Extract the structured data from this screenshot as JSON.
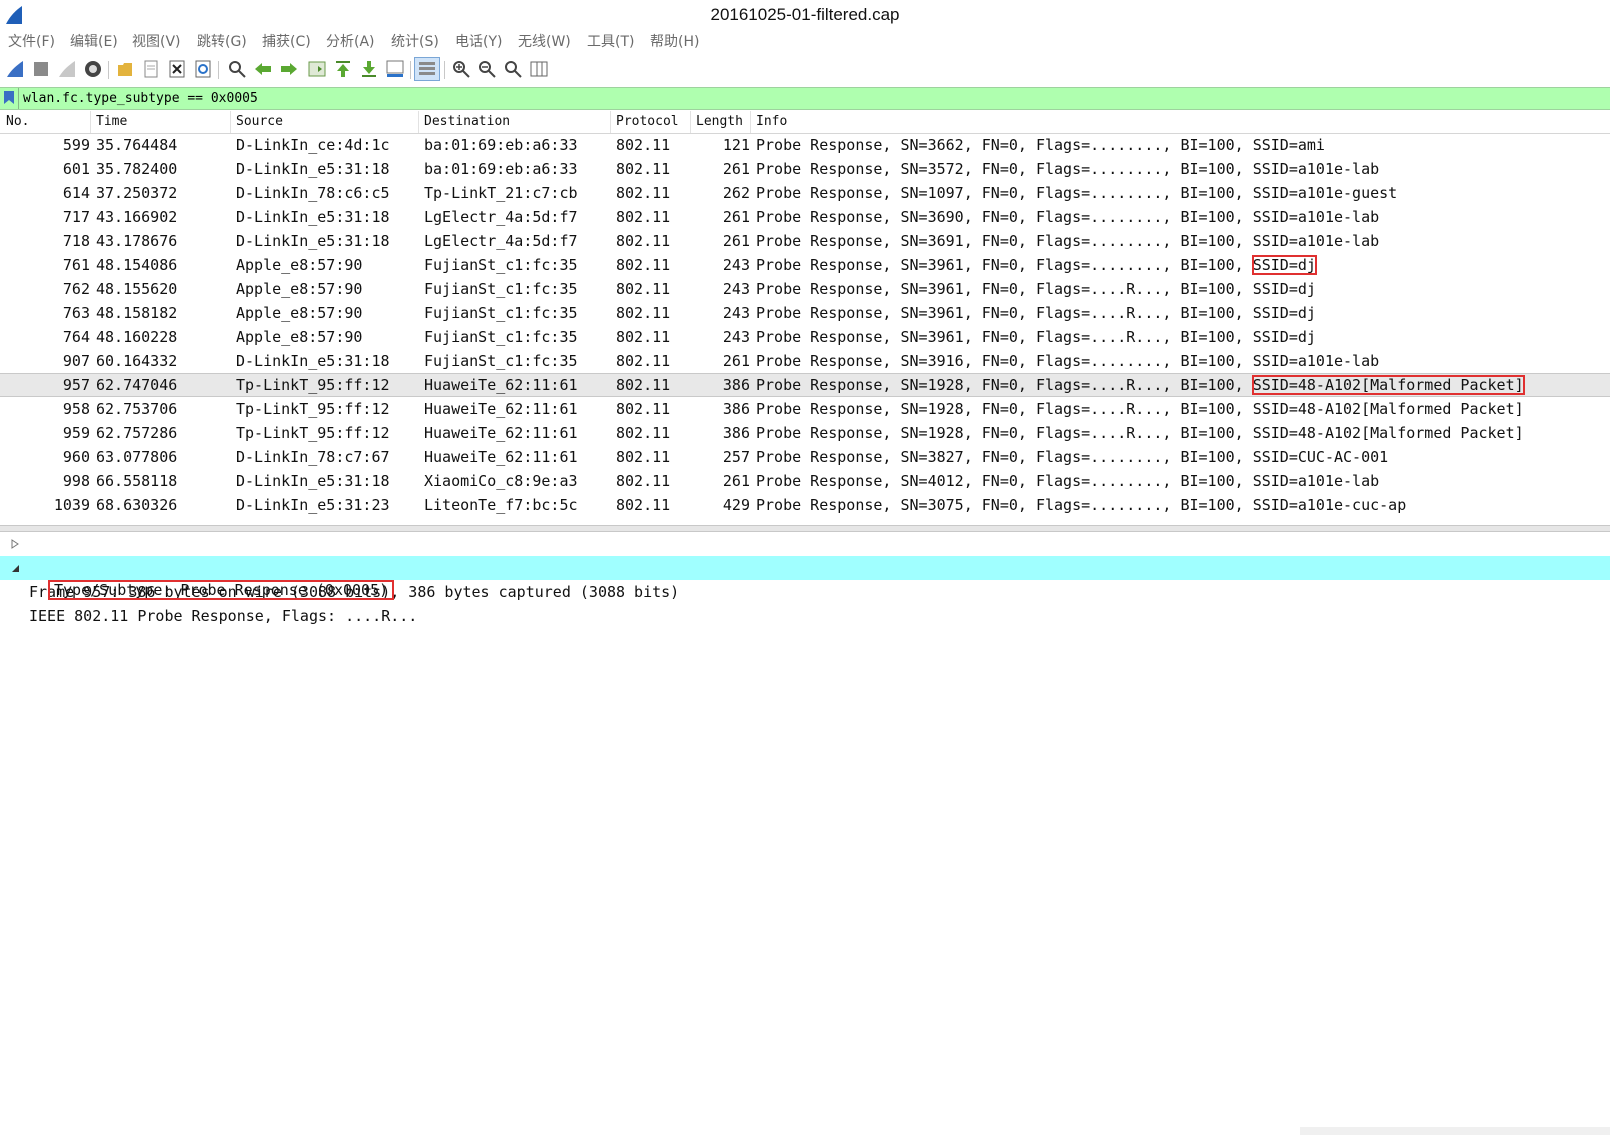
{
  "window": {
    "title": "20161025-01-filtered.cap"
  },
  "menu": [
    "文件(F)",
    "编辑(E)",
    "视图(V)",
    "跳转(G)",
    "捕获(C)",
    "分析(A)",
    "统计(S)",
    "电话(Y)",
    "无线(W)",
    "工具(T)",
    "帮助(H)"
  ],
  "filter": {
    "value": "wlan.fc.type_subtype == 0x0005"
  },
  "columns": {
    "no": "No.",
    "time": "Time",
    "source": "Source",
    "destination": "Destination",
    "protocol": "Protocol",
    "length": "Length",
    "info": "Info"
  },
  "packets": [
    {
      "no": "599",
      "time": "35.764484",
      "source": "D-LinkIn_ce:4d:1c",
      "destination": "ba:01:69:eb:a6:33",
      "protocol": "802.11",
      "length": "121",
      "info": "Probe Response, SN=3662, FN=0, Flags=........, BI=100, ",
      "ssid": "SSID=ami"
    },
    {
      "no": "601",
      "time": "35.782400",
      "source": "D-LinkIn_e5:31:18",
      "destination": "ba:01:69:eb:a6:33",
      "protocol": "802.11",
      "length": "261",
      "info": "Probe Response, SN=3572, FN=0, Flags=........, BI=100, ",
      "ssid": "SSID=a101e-lab"
    },
    {
      "no": "614",
      "time": "37.250372",
      "source": "D-LinkIn_78:c6:c5",
      "destination": "Tp-LinkT_21:c7:cb",
      "protocol": "802.11",
      "length": "262",
      "info": "Probe Response, SN=1097, FN=0, Flags=........, BI=100, ",
      "ssid": "SSID=a101e-guest"
    },
    {
      "no": "717",
      "time": "43.166902",
      "source": "D-LinkIn_e5:31:18",
      "destination": "LgElectr_4a:5d:f7",
      "protocol": "802.11",
      "length": "261",
      "info": "Probe Response, SN=3690, FN=0, Flags=........, BI=100, ",
      "ssid": "SSID=a101e-lab"
    },
    {
      "no": "718",
      "time": "43.178676",
      "source": "D-LinkIn_e5:31:18",
      "destination": "LgElectr_4a:5d:f7",
      "protocol": "802.11",
      "length": "261",
      "info": "Probe Response, SN=3691, FN=0, Flags=........, BI=100, ",
      "ssid": "SSID=a101e-lab"
    },
    {
      "no": "761",
      "time": "48.154086",
      "source": "Apple_e8:57:90",
      "destination": "FujianSt_c1:fc:35",
      "protocol": "802.11",
      "length": "243",
      "info": "Probe Response, SN=3961, FN=0, Flags=........, BI=100, ",
      "ssid": "SSID=dj"
    },
    {
      "no": "762",
      "time": "48.155620",
      "source": "Apple_e8:57:90",
      "destination": "FujianSt_c1:fc:35",
      "protocol": "802.11",
      "length": "243",
      "info": "Probe Response, SN=3961, FN=0, Flags=....R..., BI=100, ",
      "ssid": "SSID=dj"
    },
    {
      "no": "763",
      "time": "48.158182",
      "source": "Apple_e8:57:90",
      "destination": "FujianSt_c1:fc:35",
      "protocol": "802.11",
      "length": "243",
      "info": "Probe Response, SN=3961, FN=0, Flags=....R..., BI=100, ",
      "ssid": "SSID=dj"
    },
    {
      "no": "764",
      "time": "48.160228",
      "source": "Apple_e8:57:90",
      "destination": "FujianSt_c1:fc:35",
      "protocol": "802.11",
      "length": "243",
      "info": "Probe Response, SN=3961, FN=0, Flags=....R..., BI=100, ",
      "ssid": "SSID=dj"
    },
    {
      "no": "907",
      "time": "60.164332",
      "source": "D-LinkIn_e5:31:18",
      "destination": "FujianSt_c1:fc:35",
      "protocol": "802.11",
      "length": "261",
      "info": "Probe Response, SN=3916, FN=0, Flags=........, BI=100, ",
      "ssid": "SSID=a101e-lab"
    },
    {
      "no": "957",
      "time": "62.747046",
      "source": "Tp-LinkT_95:ff:12",
      "destination": "HuaweiTe_62:11:61",
      "protocol": "802.11",
      "length": "386",
      "info": "Probe Response, SN=1928, FN=0, Flags=....R..., BI=100, ",
      "ssid": "SSID=48-A102[Malformed Packet]"
    },
    {
      "no": "958",
      "time": "62.753706",
      "source": "Tp-LinkT_95:ff:12",
      "destination": "HuaweiTe_62:11:61",
      "protocol": "802.11",
      "length": "386",
      "info": "Probe Response, SN=1928, FN=0, Flags=....R..., BI=100, ",
      "ssid": "SSID=48-A102[Malformed Packet]"
    },
    {
      "no": "959",
      "time": "62.757286",
      "source": "Tp-LinkT_95:ff:12",
      "destination": "HuaweiTe_62:11:61",
      "protocol": "802.11",
      "length": "386",
      "info": "Probe Response, SN=1928, FN=0, Flags=....R..., BI=100, ",
      "ssid": "SSID=48-A102[Malformed Packet]"
    },
    {
      "no": "960",
      "time": "63.077806",
      "source": "D-LinkIn_78:c7:67",
      "destination": "HuaweiTe_62:11:61",
      "protocol": "802.11",
      "length": "257",
      "info": "Probe Response, SN=3827, FN=0, Flags=........, BI=100, ",
      "ssid": "SSID=CUC-AC-001"
    },
    {
      "no": "998",
      "time": "66.558118",
      "source": "D-LinkIn_e5:31:18",
      "destination": "XiaomiCo_c8:9e:a3",
      "protocol": "802.11",
      "length": "261",
      "info": "Probe Response, SN=4012, FN=0, Flags=........, BI=100, ",
      "ssid": "SSID=a101e-lab"
    },
    {
      "no": "1039",
      "time": "68.630326",
      "source": "D-LinkIn_e5:31:23",
      "destination": "LiteonTe_f7:bc:5c",
      "protocol": "802.11",
      "length": "429",
      "info": "Probe Response, SN=3075, FN=0, Flags=........, BI=100, ",
      "ssid": "SSID=a101e-cuc-ap"
    }
  ],
  "details": {
    "frame": "Frame 957: 386 bytes on wire (3088 bits), 386 bytes captured (3088 bits)",
    "ieee": "IEEE 802.11 Probe Response, Flags: ....R...",
    "subtype": "Type/Subtype: Probe Response (0x0005)"
  },
  "colors": {
    "filter_bg": "#afffaf",
    "selected_row": "#e8e8e8",
    "detail_highlight": "#a0ffff",
    "annotation": "#e03030"
  }
}
